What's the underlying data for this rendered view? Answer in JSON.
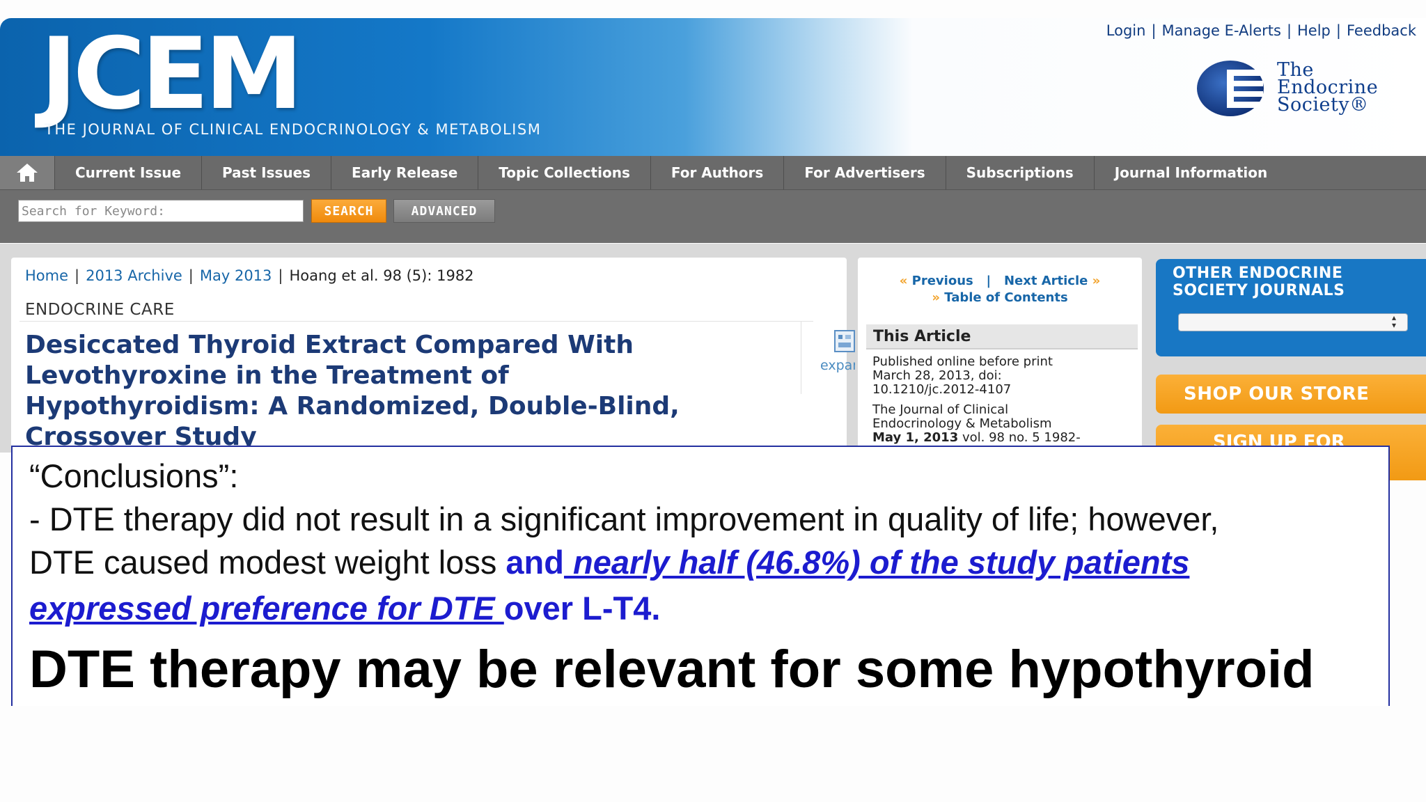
{
  "header": {
    "logo_text": "JCEM",
    "logo_subtitle": "THE JOURNAL OF CLINICAL ENDOCRINOLOGY & METABOLISM",
    "top_links": [
      "Login",
      "Manage E-Alerts",
      "Help",
      "Feedback"
    ],
    "society_name_line1": "The",
    "society_name_line2": "Endocrine",
    "society_name_line3": "Society®"
  },
  "nav": {
    "items": [
      "Current Issue",
      "Past Issues",
      "Early Release",
      "Topic Collections",
      "For Authors",
      "For Advertisers",
      "Subscriptions",
      "Journal Information"
    ]
  },
  "search": {
    "placeholder": "Search for Keyword:",
    "search_label": "SEARCH",
    "advanced_label": "ADVANCED"
  },
  "breadcrumb": {
    "home": "Home",
    "archive": "2013 Archive",
    "issue": "May 2013",
    "citation": "Hoang et al. 98 (5): 1982"
  },
  "article": {
    "section": "ENDOCRINE CARE",
    "title": "Desiccated Thyroid Extract Compared With Levothyroxine in the Treatment of Hypothyroidism: A Randomized, Double-Blind, Crossover Study",
    "expand_text": "expand article"
  },
  "side": {
    "previous": "Previous",
    "next": "Next Article",
    "toc": "Table of Contents",
    "this_article": "This Article",
    "pub_line1": "Published online before print",
    "pub_line2": "March 28, 2013, doi:",
    "pub_line3": "10.1210/jc.2012-4107",
    "journal_line1": "The Journal of Clinical",
    "journal_line2": "Endocrinology & Metabolism",
    "journal_date": "May 1, 2013",
    "journal_vol": " vol. 98 no. 5 1982-"
  },
  "right": {
    "other_journals": "OTHER ENDOCRINE SOCIETY JOURNALS",
    "shop": "SHOP OUR STORE",
    "signup": "SIGN UP FOR"
  },
  "overlay": {
    "heading": "“Conclusions”:",
    "line2": "- DTE therapy did not result in a significant improvement in quality of life; however,",
    "line3_plain": "DTE caused modest weight loss ",
    "line3_blue": "and",
    "line3_link": " nearly half (46.8%) of the study patients",
    "line4_link": "expressed preference for DTE ",
    "line4_blue": "over L-T4.",
    "line5": "DTE therapy may be relevant for some hypothyroid"
  },
  "colors": {
    "header_blue": "#0b63ad",
    "nav_gray": "#6a6a6a",
    "title_navy": "#1c3a76",
    "link_blue": "#1766a8",
    "accent_orange": "#f29a14",
    "overlay_blue": "#1c1ccf"
  }
}
